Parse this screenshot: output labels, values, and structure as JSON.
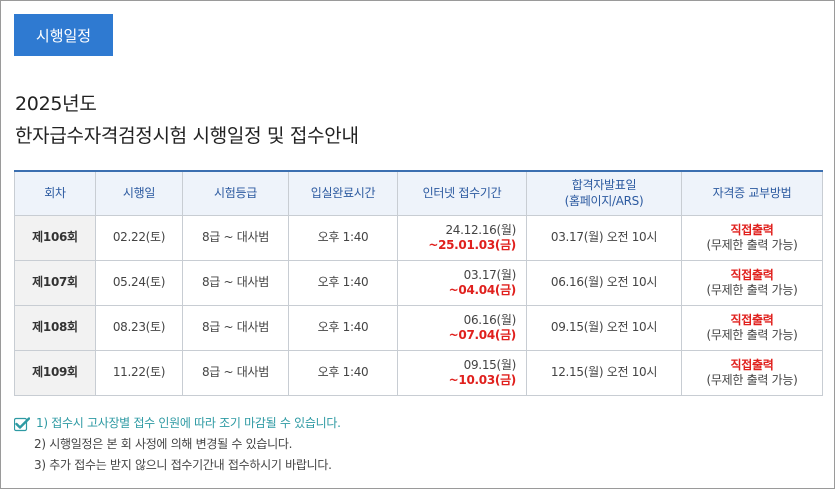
{
  "tab": {
    "label": "시행일정"
  },
  "heading": {
    "year": "2025년도",
    "title": "한자급수자격검정시험 시행일정 및 접수안내"
  },
  "table": {
    "headers": {
      "round": "회차",
      "exam_date": "시행일",
      "grade": "시험등급",
      "entry_time": "입실완료시간",
      "registration": "인터넷 접수기간",
      "result_line1": "합격자발표일",
      "result_line2": "(홈페이지/ARS)",
      "cert": "자격증 교부방법"
    },
    "rows": [
      {
        "round": "제106회",
        "exam_date": "02.22(토)",
        "grade": "8급 ~ 대사범",
        "entry_time": "오후 1:40",
        "reg_start": "24.12.16(월)",
        "reg_end": "~25.01.03(금)",
        "result": "03.17(월) 오전 10시",
        "cert_main": "직접출력",
        "cert_sub": "(무제한 출력 가능)"
      },
      {
        "round": "제107회",
        "exam_date": "05.24(토)",
        "grade": "8급 ~ 대사범",
        "entry_time": "오후 1:40",
        "reg_start": "03.17(월)",
        "reg_end": "~04.04(금)",
        "result": "06.16(월) 오전 10시",
        "cert_main": "직접출력",
        "cert_sub": "(무제한 출력 가능)"
      },
      {
        "round": "제108회",
        "exam_date": "08.23(토)",
        "grade": "8급 ~ 대사범",
        "entry_time": "오후 1:40",
        "reg_start": "06.16(월)",
        "reg_end": "~07.04(금)",
        "result": "09.15(월) 오전 10시",
        "cert_main": "직접출력",
        "cert_sub": "(무제한 출력 가능)"
      },
      {
        "round": "제109회",
        "exam_date": "11.22(토)",
        "grade": "8급 ~ 대사범",
        "entry_time": "오후 1:40",
        "reg_start": "09.15(월)",
        "reg_end": "~10.03(금)",
        "result": "12.15(월) 오전 10시",
        "cert_main": "직접출력",
        "cert_sub": "(무제한 출력 가능)"
      }
    ]
  },
  "notes": [
    "1) 접수시 고사장별 접수 인원에 따라 조기 마감될 수 있습니다.",
    "2) 시행일정은 본 회 사정에 의해 변경될 수 있습니다.",
    "3) 추가 접수는 받지 않으니 접수기간내 접수하시기 바랍니다."
  ],
  "colors": {
    "accent": "#2f7ad1",
    "header_text": "#2c5aa0",
    "highlight": "#e0201d",
    "note_teal": "#2e9aa3"
  },
  "icons": {
    "note_check": "check-icon"
  }
}
